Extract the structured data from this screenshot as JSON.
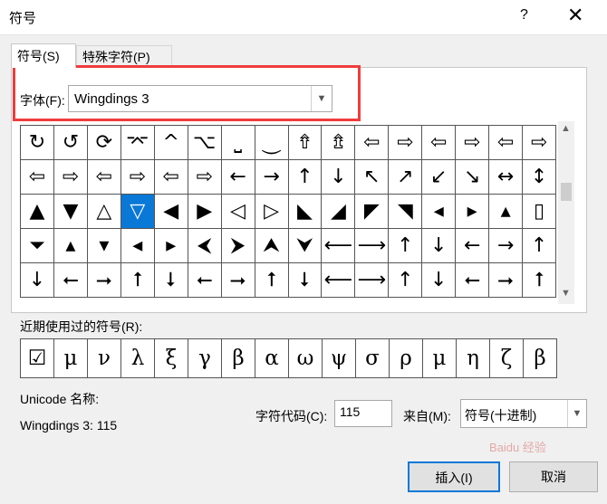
{
  "dialog": {
    "title": "符号",
    "help_label": "?",
    "close_label": "✕"
  },
  "tabs": [
    {
      "label": "符号(S)"
    },
    {
      "label": "特殊字符(P)"
    }
  ],
  "font": {
    "label": "字体(F):",
    "value": "Wingdings 3"
  },
  "symbols": [
    [
      "↻",
      "↺",
      "⟳",
      "⌤",
      "^",
      "⌥",
      "⎵",
      "⏝",
      "⇮",
      "⇯",
      "⇦",
      "⇨",
      "⇦",
      "⇨",
      "⇦",
      "⇨"
    ],
    [
      "⇦",
      "⇨",
      "⇦",
      "⇨",
      "⇦",
      "⇨",
      "←",
      "→",
      "↑",
      "↓",
      "↖",
      "↗",
      "↙",
      "↘",
      "↔",
      "↕"
    ],
    [
      "▲",
      "▼",
      "△",
      "▽",
      "◀",
      "▶",
      "◁",
      "▷",
      "◣",
      "◢",
      "◤",
      "◥",
      "◂",
      "▸",
      "▴",
      "▯"
    ],
    [
      "⏷",
      "▴",
      "▾",
      "◂",
      "▸",
      "⮜",
      "⮞",
      "⮝",
      "⮟",
      "⟵",
      "⟶",
      "↑",
      "↓",
      "←",
      "→",
      "↑"
    ],
    [
      "↓",
      "⭠",
      "⭢",
      "⭡",
      "⭣",
      "⭠",
      "⭢",
      "⭡",
      "⭣",
      "⟵",
      "⟶",
      "↑",
      "↓",
      "⭠",
      "⭢",
      "⭡"
    ]
  ],
  "selected_symbol": "▽",
  "recent": {
    "label": "近期使用过的符号(R):",
    "symbols": [
      "☑",
      "μ",
      "ν",
      "λ",
      "ξ",
      "γ",
      "β",
      "α",
      "ω",
      "ψ",
      "σ",
      "ρ",
      "μ",
      "η",
      "ζ",
      "β"
    ]
  },
  "unicode_name": {
    "label": "Unicode 名称:",
    "value": "Wingdings 3: 115"
  },
  "char_code": {
    "label": "字符代码(C):",
    "value": "115"
  },
  "from": {
    "label": "来自(M):",
    "value": "符号(十进制)"
  },
  "buttons": {
    "insert": "插入(I)",
    "cancel": "取消"
  },
  "watermark": "Baidu 经验"
}
